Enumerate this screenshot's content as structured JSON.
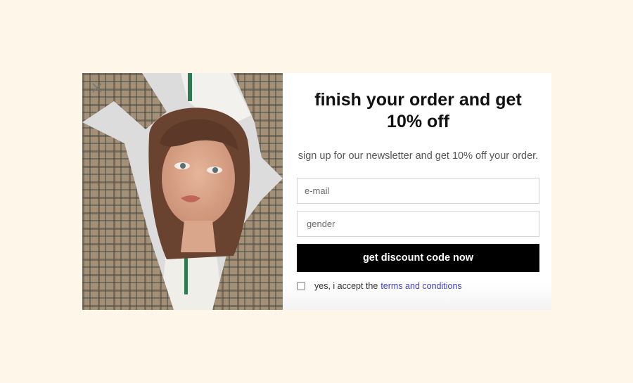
{
  "popup": {
    "close_label": "×",
    "title_line1": "finish your order and get",
    "title_line2": "10% off",
    "subtitle": "sign up for our newsletter and get 10% off your order.",
    "email_placeholder": "e-mail",
    "gender_placeholder": "gender",
    "cta_label": "get discount code now",
    "consent_text": "yes, i accept the",
    "consent_link": "terms and conditions"
  },
  "colors": {
    "page_background": "#fef6e9",
    "cta_background": "#000000",
    "link": "#3b3bd6"
  },
  "icons": {
    "close": "close-icon"
  }
}
